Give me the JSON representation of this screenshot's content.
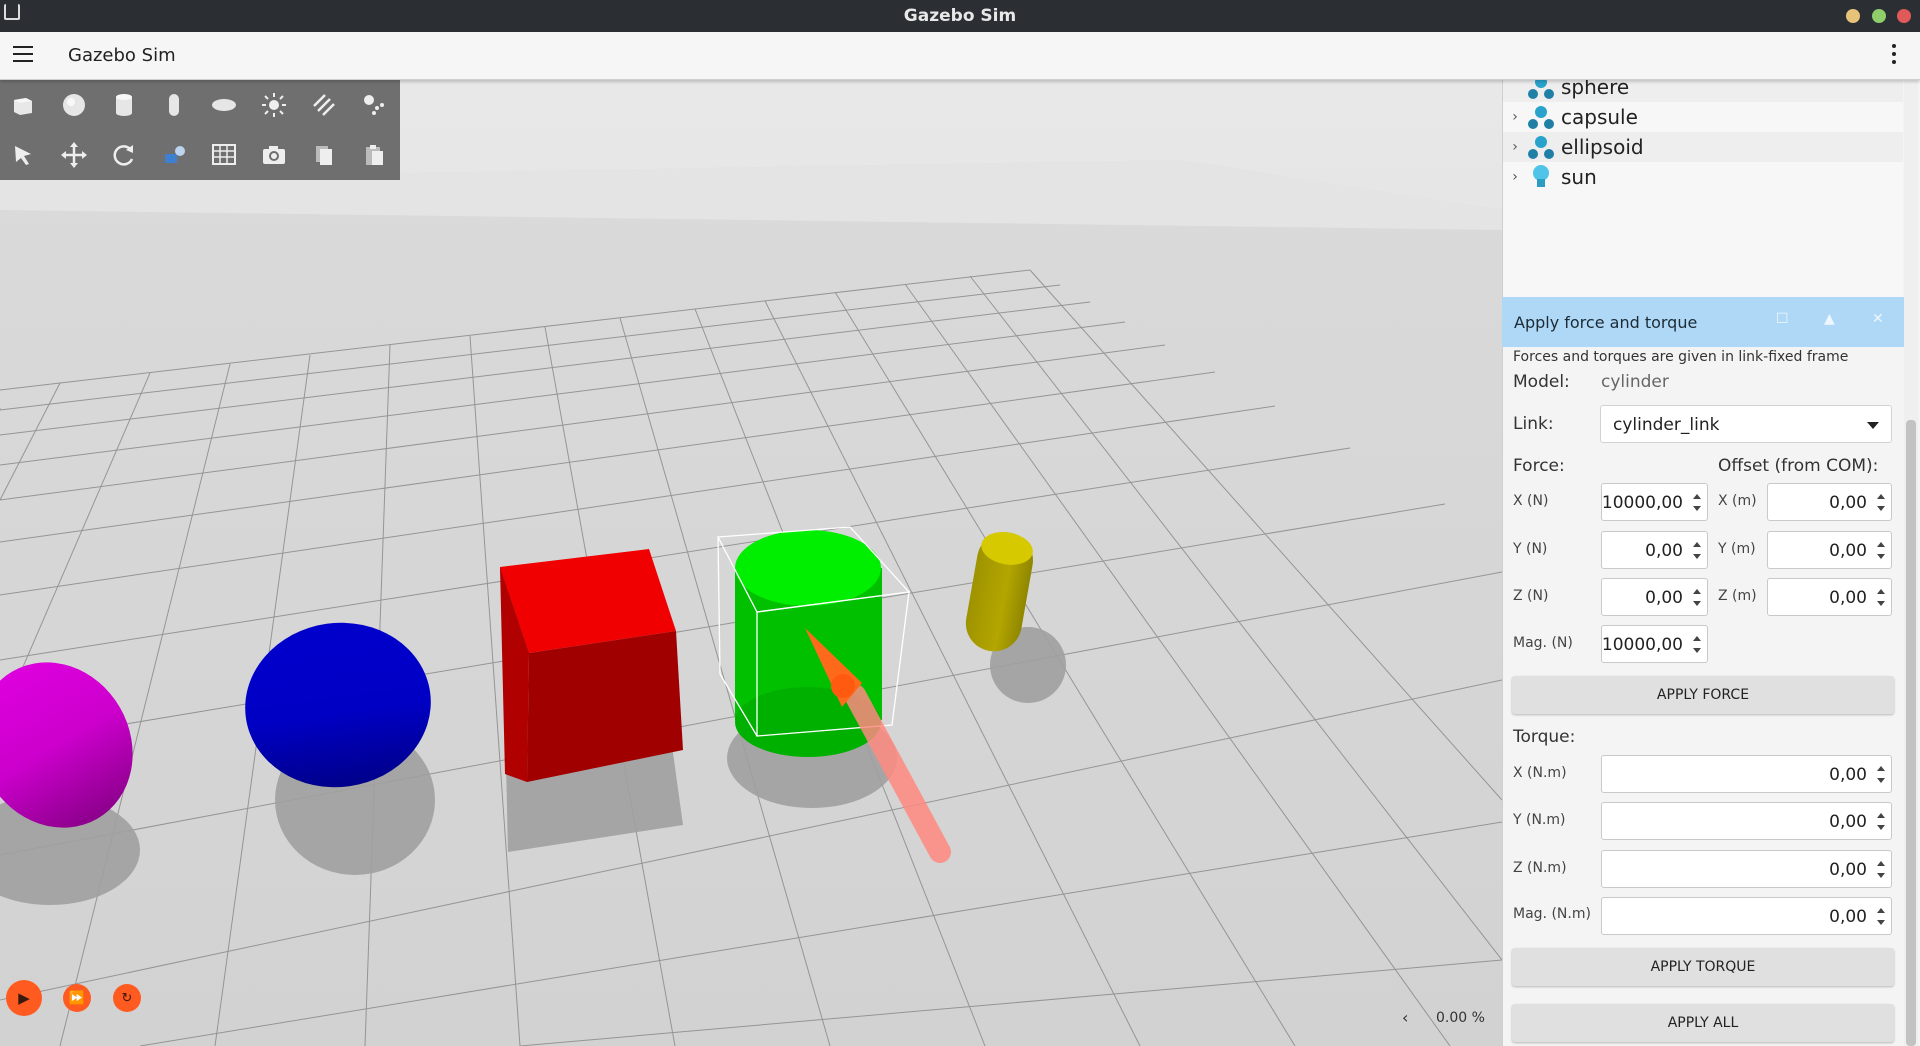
{
  "window": {
    "title": "Gazebo Sim"
  },
  "header": {
    "title": "Gazebo Sim"
  },
  "colors": {
    "accent_orange": "#ff5a1f",
    "plugin_header": "#aed8f5",
    "sphere": "#0000cc",
    "box": "#e60000",
    "cylinder": "#00dd00",
    "capsule": "#b3a600",
    "ellipsoid": "#cc00cc",
    "force_arrow": "#ff6a2a"
  },
  "toolbar": {
    "row1": [
      "box-icon",
      "sphere-icon",
      "cylinder-icon",
      "capsule-icon",
      "ellipsoid-icon",
      "sun-icon",
      "directional-light-icon",
      "spot-light-icon"
    ],
    "row2": [
      "select-icon",
      "translate-icon",
      "rotate-icon",
      "transform-icon",
      "grid-icon",
      "camera-icon",
      "copy-icon",
      "paste-icon"
    ]
  },
  "entity_tree": {
    "items": [
      {
        "label": "sphere",
        "icon": "model-icon"
      },
      {
        "label": "capsule",
        "icon": "model-icon"
      },
      {
        "label": "ellipsoid",
        "icon": "model-icon"
      },
      {
        "label": "sun",
        "icon": "light-bulb-icon"
      }
    ]
  },
  "plugin": {
    "title": "Apply force and torque",
    "note": "Forces and torques are given in link-fixed frame",
    "model_label": "Model:",
    "model_value": "cylinder",
    "link_label": "Link:",
    "link_value": "cylinder_link",
    "force_label": "Force:",
    "offset_label": "Offset (from COM):",
    "force": {
      "x_label": "X (N)",
      "x": "10000,00",
      "y_label": "Y (N)",
      "y": "0,00",
      "z_label": "Z (N)",
      "z": "0,00",
      "mag_label": "Mag. (N)",
      "mag": "10000,00"
    },
    "offset": {
      "x_label": "X (m)",
      "x": "0,00",
      "y_label": "Y (m)",
      "y": "0,00",
      "z_label": "Z (m)",
      "z": "0,00"
    },
    "apply_force": "APPLY FORCE",
    "torque_label": "Torque:",
    "torque": {
      "x_label": "X (N.m)",
      "x": "0,00",
      "y_label": "Y (N.m)",
      "y": "0,00",
      "z_label": "Z (N.m)",
      "z": "0,00",
      "mag_label": "Mag. (N.m)",
      "mag": "0,00"
    },
    "apply_torque": "APPLY TORQUE",
    "apply_all": "APPLY ALL"
  },
  "status": {
    "rtf": "0.00 %"
  }
}
